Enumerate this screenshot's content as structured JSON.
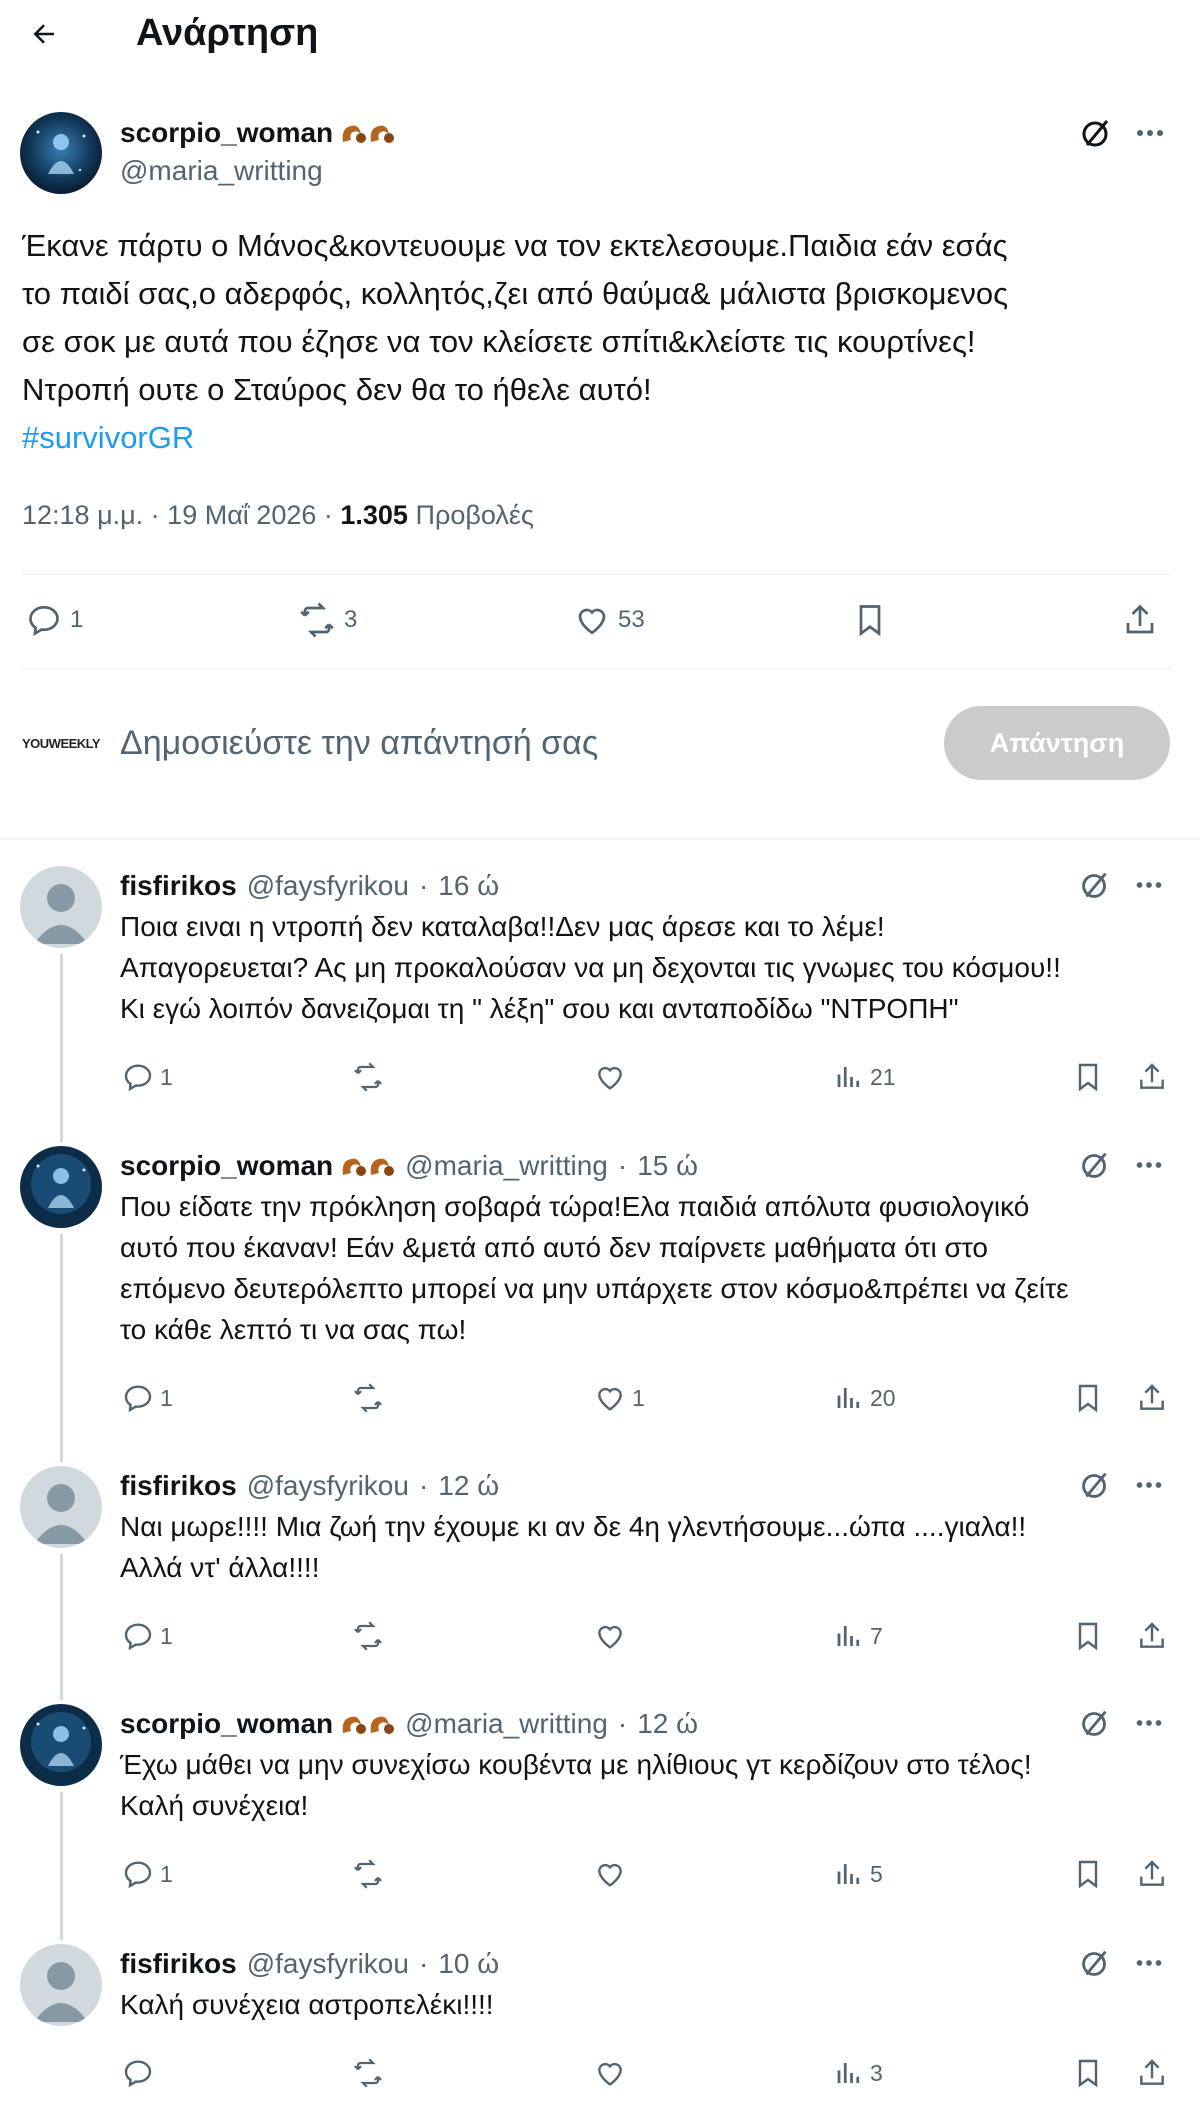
{
  "header": {
    "title": "Ανάρτηση"
  },
  "post": {
    "author_name": "scorpio_woman",
    "author_handle": "@maria_writting",
    "text_lines": [
      "Έκανε πάρτυ ο Μάνος&κοντευουμε να τον εκτελεσουμε.Παιδια εάν εσάς",
      "το παιδί σας,ο αδερφός, κολλητός,ζει από θαύμα& μάλιστα βρισκομενος",
      "σε σοκ με αυτά που έζησε να τον κλείσετε σπίτι&κλείστε τις κουρτίνες!",
      "Ντροπή ουτε ο Σταύρος δεν θα το ήθελε αυτό!"
    ],
    "hashtag": "#survivorGR",
    "timestamp": "12:18 μ.μ. · 19 Μαΐ 2026 · ",
    "views": "1.305",
    "views_label": "Προβολές",
    "replies": "1",
    "reposts": "3",
    "likes": "53"
  },
  "composer": {
    "avatar_label": "YOUWEEKLY",
    "placeholder": "Δημοσιεύστε την απάντησή σας",
    "button_label": "Απάντηση"
  },
  "replies": [
    {
      "name": "fisfirikos",
      "handle": "@faysfyrikou",
      "time": "16 ώ",
      "avatar": "default",
      "lines": [
        "Ποια ειναι η ντροπή δεν καταλαβα!!Δεν μας άρεσε και το λέμε!",
        "Απαγορευεται? Ας μη προκαλούσαν να μη δεχονται τις γνωμες του κόσμου!!",
        "Κι εγώ λοιπόν δανειζομαι τη \" λέξη\" σου και ανταποδίδω \"ΝΤΡΟΠΗ\""
      ],
      "replies": "1",
      "reposts": "",
      "likes": "",
      "views": "21"
    },
    {
      "name": "scorpio_woman",
      "handle": "@maria_writting",
      "time": "15 ώ",
      "avatar": "scorpio",
      "lines": [
        "Που είδατε την πρόκληση σοβαρά τώρα!Ελα παιδιά απόλυτα φυσιολογικό",
        "αυτό που έκαναν! Εάν &μετά από αυτό δεν παίρνετε μαθήματα ότι στο",
        "επόμενο δευτερόλεπτο μπορεί να μην υπάρχετε στον κόσμο&πρέπει να ζείτε",
        "το κάθε λεπτό τι να σας πω!"
      ],
      "replies": "1",
      "reposts": "",
      "likes": "1",
      "views": "20"
    },
    {
      "name": "fisfirikos",
      "handle": "@faysfyrikou",
      "time": "12 ώ",
      "avatar": "default",
      "lines": [
        "Ναι μωρε!!!! Μια ζωή την έχουμε κι αν δε 4η γλεντήσουμε...ώπα ....γιαλα!!",
        "Αλλά ντ' άλλα!!!!"
      ],
      "replies": "1",
      "reposts": "",
      "likes": "",
      "views": "7"
    },
    {
      "name": "scorpio_woman",
      "handle": "@maria_writting",
      "time": "12 ώ",
      "avatar": "scorpio",
      "lines": [
        "Έχω μάθει να μην συνεχίσω κουβέντα με ηλίθιους γτ κερδίζουν στο τέλος!",
        "Καλή συνέχεια!"
      ],
      "replies": "1",
      "reposts": "",
      "likes": "",
      "views": "5"
    },
    {
      "name": "fisfirikos",
      "handle": "@faysfyrikou",
      "time": "10 ώ",
      "avatar": "default",
      "lines": [
        "Καλή συνέχεια αστροπελέκι!!!!"
      ],
      "replies": "",
      "reposts": "",
      "likes": "",
      "views": "3"
    }
  ],
  "colors": {
    "accent": "#1d9bf0",
    "muted": "#536471",
    "text": "#0f1419",
    "button_disabled": "#c9cbcd"
  },
  "icons": [
    "back-arrow-icon",
    "grok-icon",
    "more-icon",
    "reply-icon",
    "repost-icon",
    "like-icon",
    "views-icon",
    "bookmark-icon",
    "share-icon",
    "scorpion-emoji-icon"
  ]
}
